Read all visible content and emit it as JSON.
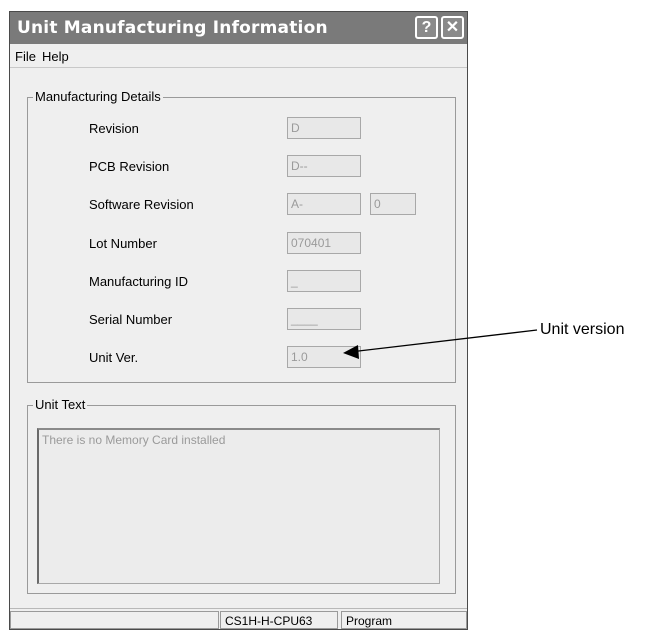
{
  "window": {
    "title": "Unit Manufacturing Information",
    "help_button": "?",
    "close_button": "✕"
  },
  "menu": [
    "File",
    "Help"
  ],
  "details": {
    "group_label": "Manufacturing Details",
    "rows": [
      {
        "label": "Revision",
        "value": "D"
      },
      {
        "label": "PCB Revision",
        "value": "D--"
      },
      {
        "label": "Software Revision",
        "value": "A-",
        "value2": "0"
      },
      {
        "label": "Lot Number",
        "value": "070401"
      },
      {
        "label": "Manufacturing ID",
        "value": "_"
      },
      {
        "label": "Serial Number",
        "value": "____"
      },
      {
        "label": "Unit Ver.",
        "value": "1.0"
      }
    ]
  },
  "unit_text": {
    "group_label": "Unit Text",
    "content": "There is no Memory Card installed"
  },
  "status": {
    "model": "CS1H-H-CPU63",
    "mode": "Program"
  },
  "annotation": {
    "label": "Unit version"
  }
}
